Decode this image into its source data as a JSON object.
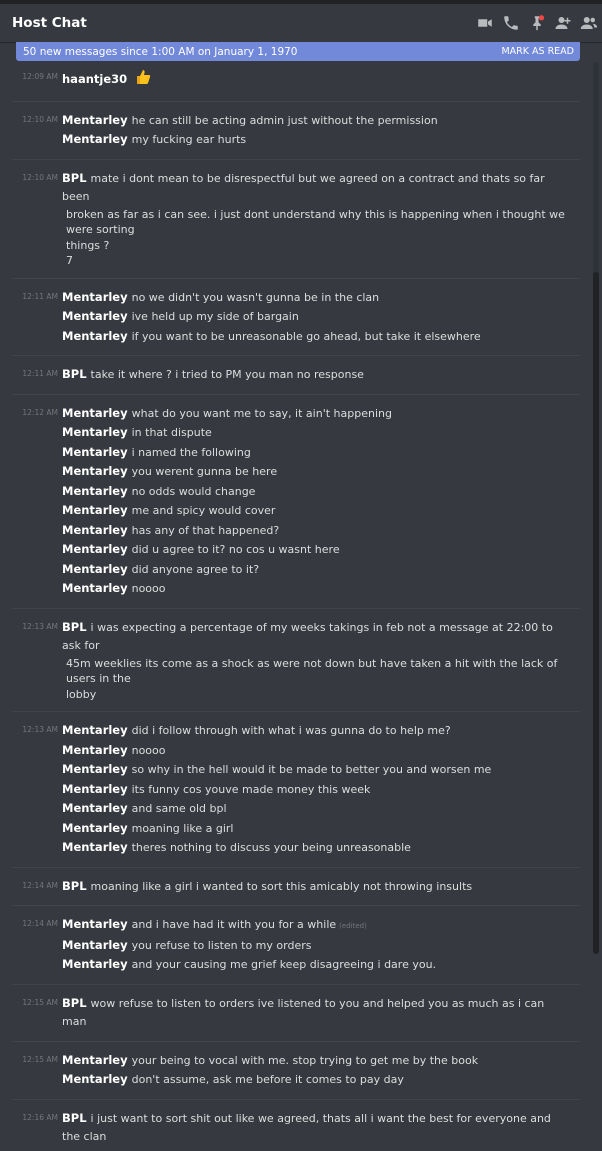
{
  "header": {
    "title": "Host Chat"
  },
  "icons": [
    "video-call-icon",
    "voice-call-icon",
    "pinned-messages-icon",
    "add-friend-icon",
    "member-list-icon"
  ],
  "banner": {
    "text": "50 new messages since 1:00 AM on January 1, 1970",
    "action": "MARK AS READ"
  },
  "colors": {
    "background": "#36393f",
    "banner": "#7289da",
    "header_text": "#ffffff"
  },
  "groups": [
    {
      "time": "12:09 AM",
      "messages": [
        {
          "author": "haantje30",
          "text": "",
          "emoji": "thumbs-up"
        }
      ]
    },
    {
      "time": "12:10 AM",
      "messages": [
        {
          "author": "Mentarley",
          "text": "he can still be acting admin just without the permission"
        },
        {
          "author": "Mentarley",
          "text": "my fucking ear hurts"
        }
      ]
    },
    {
      "time": "12:10 AM",
      "messages": [
        {
          "author": "BPL",
          "text": "mate i dont mean to be disrespectful but we agreed on a contract and thats so far been",
          "cont": [
            "broken as far as i can see. i just dont understand why this is happening when i thought we were sorting",
            "things ?",
            "7"
          ]
        }
      ]
    },
    {
      "time": "12:11 AM",
      "messages": [
        {
          "author": "Mentarley",
          "text": "no we didn't you wasn't gunna be in the clan"
        },
        {
          "author": "Mentarley",
          "text": "ive held up my side of bargain"
        },
        {
          "author": "Mentarley",
          "text": "if you want to be unreasonable go ahead, but take it elsewhere"
        }
      ]
    },
    {
      "time": "12:11 AM",
      "messages": [
        {
          "author": "BPL",
          "text": "take it where ? i tried to PM you man no response"
        }
      ]
    },
    {
      "time": "12:12 AM",
      "messages": [
        {
          "author": "Mentarley",
          "text": "what do you want me to say, it ain't happening"
        },
        {
          "author": "Mentarley",
          "text": "in that dispute"
        },
        {
          "author": "Mentarley",
          "text": "i named the following"
        },
        {
          "author": "Mentarley",
          "text": "you werent gunna be here"
        },
        {
          "author": "Mentarley",
          "text": "no odds would change"
        },
        {
          "author": "Mentarley",
          "text": "me and spicy would cover"
        },
        {
          "author": "Mentarley",
          "text": "has any of that happened?"
        },
        {
          "author": "Mentarley",
          "text": "did u agree to it? no cos u wasnt here"
        },
        {
          "author": "Mentarley",
          "text": "did anyone agree to it?"
        },
        {
          "author": "Mentarley",
          "text": "noooo"
        }
      ]
    },
    {
      "time": "12:13 AM",
      "messages": [
        {
          "author": "BPL",
          "text": "i was expecting a percentage of my weeks takings in feb not a message at 22:00 to ask for",
          "cont": [
            "45m weeklies its come as a shock as were not down but have taken a hit with the lack of users in the",
            "lobby"
          ]
        }
      ]
    },
    {
      "time": "12:13 AM",
      "messages": [
        {
          "author": "Mentarley",
          "text": "did i follow through with what i was gunna do to help me?"
        },
        {
          "author": "Mentarley",
          "text": "noooo"
        },
        {
          "author": "Mentarley",
          "text": "so why in the hell would it be made to better you and worsen me"
        },
        {
          "author": "Mentarley",
          "text": "its funny cos youve made money this week"
        },
        {
          "author": "Mentarley",
          "text": "and same old bpl"
        },
        {
          "author": "Mentarley",
          "text": "moaning like a girl"
        },
        {
          "author": "Mentarley",
          "text": "theres nothing to discuss your being unreasonable"
        }
      ]
    },
    {
      "time": "12:14 AM",
      "messages": [
        {
          "author": "BPL",
          "text": "moaning like a girl i wanted to sort this amicably not throwing insults"
        }
      ]
    },
    {
      "time": "12:14 AM",
      "messages": [
        {
          "author": "Mentarley",
          "text": "and i have had it with you for a while",
          "edited": "(edited)"
        },
        {
          "author": "Mentarley",
          "text": "you refuse to listen to my orders"
        },
        {
          "author": "Mentarley",
          "text": "and your causing me grief keep disagreeing i dare you."
        }
      ]
    },
    {
      "time": "12:15 AM",
      "messages": [
        {
          "author": "BPL",
          "text": "wow refuse to listen to orders ive listened to you and helped you as much as i can man"
        }
      ]
    },
    {
      "time": "12:15 AM",
      "messages": [
        {
          "author": "Mentarley",
          "text": "your being to vocal with me. stop trying to get me by the book"
        },
        {
          "author": "Mentarley",
          "text": "don't assume, ask me before it comes to pay day"
        }
      ]
    },
    {
      "time": "12:16 AM",
      "messages": [
        {
          "author": "BPL",
          "text": "i just want to sort shit out like we agreed, thats all i want the best for everyone and the clan"
        }
      ]
    }
  ]
}
